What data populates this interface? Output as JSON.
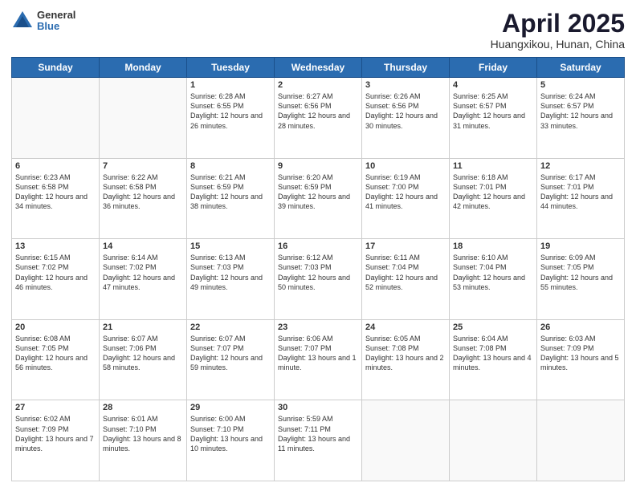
{
  "header": {
    "logo_line1": "General",
    "logo_line2": "Blue",
    "month": "April 2025",
    "location": "Huangxikou, Hunan, China"
  },
  "days_of_week": [
    "Sunday",
    "Monday",
    "Tuesday",
    "Wednesday",
    "Thursday",
    "Friday",
    "Saturday"
  ],
  "weeks": [
    [
      {
        "num": "",
        "text": ""
      },
      {
        "num": "",
        "text": ""
      },
      {
        "num": "1",
        "text": "Sunrise: 6:28 AM\nSunset: 6:55 PM\nDaylight: 12 hours and 26 minutes."
      },
      {
        "num": "2",
        "text": "Sunrise: 6:27 AM\nSunset: 6:56 PM\nDaylight: 12 hours and 28 minutes."
      },
      {
        "num": "3",
        "text": "Sunrise: 6:26 AM\nSunset: 6:56 PM\nDaylight: 12 hours and 30 minutes."
      },
      {
        "num": "4",
        "text": "Sunrise: 6:25 AM\nSunset: 6:57 PM\nDaylight: 12 hours and 31 minutes."
      },
      {
        "num": "5",
        "text": "Sunrise: 6:24 AM\nSunset: 6:57 PM\nDaylight: 12 hours and 33 minutes."
      }
    ],
    [
      {
        "num": "6",
        "text": "Sunrise: 6:23 AM\nSunset: 6:58 PM\nDaylight: 12 hours and 34 minutes."
      },
      {
        "num": "7",
        "text": "Sunrise: 6:22 AM\nSunset: 6:58 PM\nDaylight: 12 hours and 36 minutes."
      },
      {
        "num": "8",
        "text": "Sunrise: 6:21 AM\nSunset: 6:59 PM\nDaylight: 12 hours and 38 minutes."
      },
      {
        "num": "9",
        "text": "Sunrise: 6:20 AM\nSunset: 6:59 PM\nDaylight: 12 hours and 39 minutes."
      },
      {
        "num": "10",
        "text": "Sunrise: 6:19 AM\nSunset: 7:00 PM\nDaylight: 12 hours and 41 minutes."
      },
      {
        "num": "11",
        "text": "Sunrise: 6:18 AM\nSunset: 7:01 PM\nDaylight: 12 hours and 42 minutes."
      },
      {
        "num": "12",
        "text": "Sunrise: 6:17 AM\nSunset: 7:01 PM\nDaylight: 12 hours and 44 minutes."
      }
    ],
    [
      {
        "num": "13",
        "text": "Sunrise: 6:15 AM\nSunset: 7:02 PM\nDaylight: 12 hours and 46 minutes."
      },
      {
        "num": "14",
        "text": "Sunrise: 6:14 AM\nSunset: 7:02 PM\nDaylight: 12 hours and 47 minutes."
      },
      {
        "num": "15",
        "text": "Sunrise: 6:13 AM\nSunset: 7:03 PM\nDaylight: 12 hours and 49 minutes."
      },
      {
        "num": "16",
        "text": "Sunrise: 6:12 AM\nSunset: 7:03 PM\nDaylight: 12 hours and 50 minutes."
      },
      {
        "num": "17",
        "text": "Sunrise: 6:11 AM\nSunset: 7:04 PM\nDaylight: 12 hours and 52 minutes."
      },
      {
        "num": "18",
        "text": "Sunrise: 6:10 AM\nSunset: 7:04 PM\nDaylight: 12 hours and 53 minutes."
      },
      {
        "num": "19",
        "text": "Sunrise: 6:09 AM\nSunset: 7:05 PM\nDaylight: 12 hours and 55 minutes."
      }
    ],
    [
      {
        "num": "20",
        "text": "Sunrise: 6:08 AM\nSunset: 7:05 PM\nDaylight: 12 hours and 56 minutes."
      },
      {
        "num": "21",
        "text": "Sunrise: 6:07 AM\nSunset: 7:06 PM\nDaylight: 12 hours and 58 minutes."
      },
      {
        "num": "22",
        "text": "Sunrise: 6:07 AM\nSunset: 7:07 PM\nDaylight: 12 hours and 59 minutes."
      },
      {
        "num": "23",
        "text": "Sunrise: 6:06 AM\nSunset: 7:07 PM\nDaylight: 13 hours and 1 minute."
      },
      {
        "num": "24",
        "text": "Sunrise: 6:05 AM\nSunset: 7:08 PM\nDaylight: 13 hours and 2 minutes."
      },
      {
        "num": "25",
        "text": "Sunrise: 6:04 AM\nSunset: 7:08 PM\nDaylight: 13 hours and 4 minutes."
      },
      {
        "num": "26",
        "text": "Sunrise: 6:03 AM\nSunset: 7:09 PM\nDaylight: 13 hours and 5 minutes."
      }
    ],
    [
      {
        "num": "27",
        "text": "Sunrise: 6:02 AM\nSunset: 7:09 PM\nDaylight: 13 hours and 7 minutes."
      },
      {
        "num": "28",
        "text": "Sunrise: 6:01 AM\nSunset: 7:10 PM\nDaylight: 13 hours and 8 minutes."
      },
      {
        "num": "29",
        "text": "Sunrise: 6:00 AM\nSunset: 7:10 PM\nDaylight: 13 hours and 10 minutes."
      },
      {
        "num": "30",
        "text": "Sunrise: 5:59 AM\nSunset: 7:11 PM\nDaylight: 13 hours and 11 minutes."
      },
      {
        "num": "",
        "text": ""
      },
      {
        "num": "",
        "text": ""
      },
      {
        "num": "",
        "text": ""
      }
    ]
  ]
}
